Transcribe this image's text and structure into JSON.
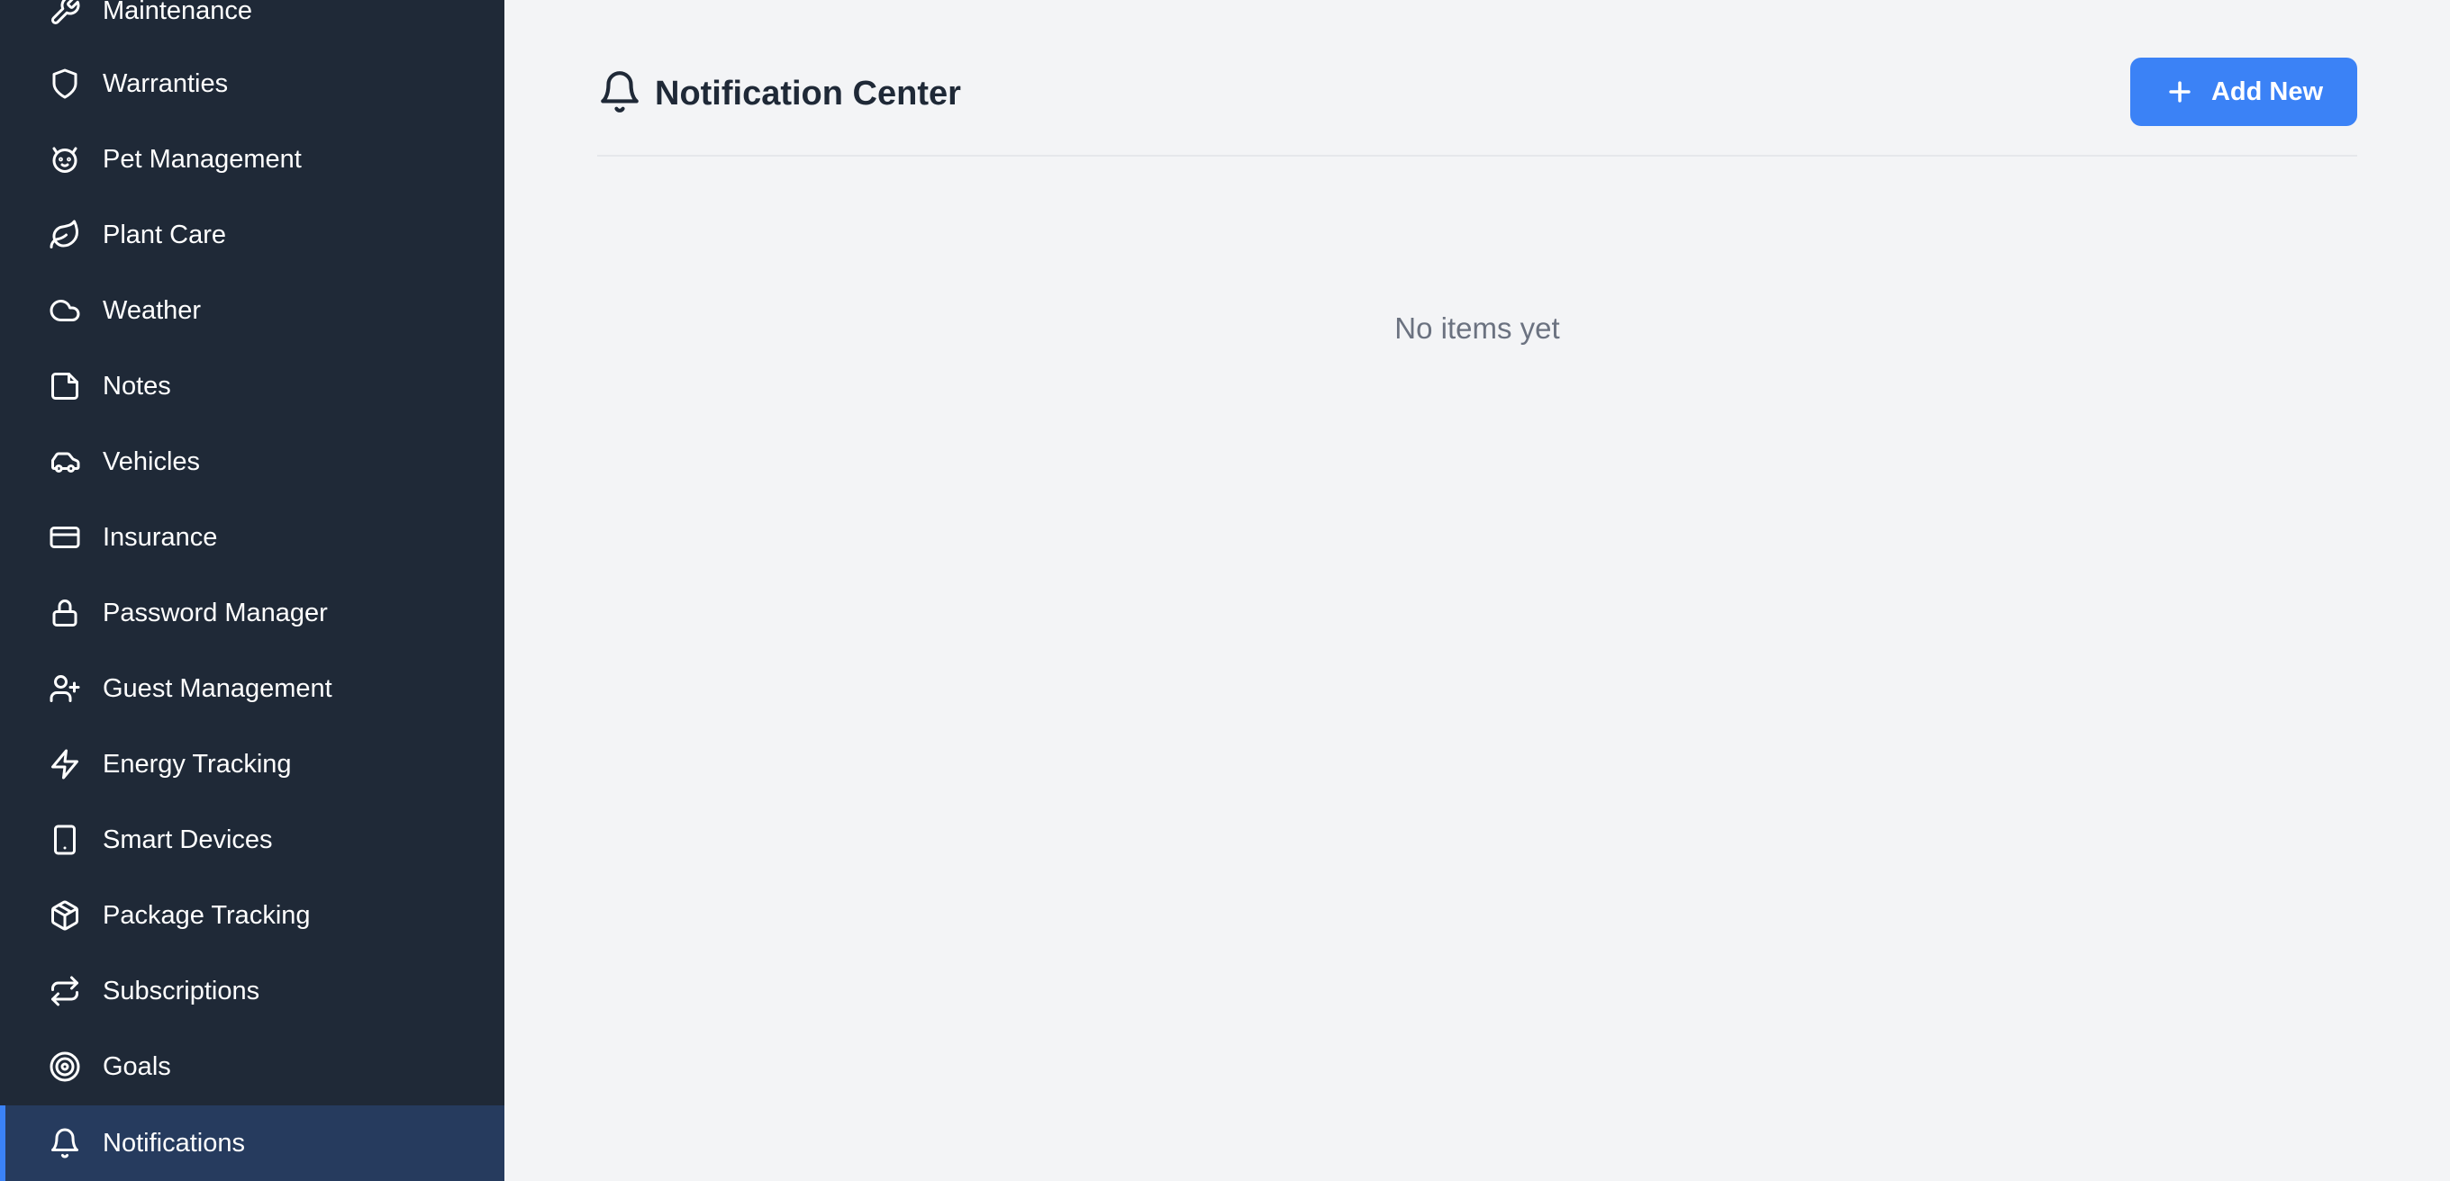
{
  "sidebar": {
    "items": [
      {
        "label": "Maintenance",
        "icon": "wrench-icon"
      },
      {
        "label": "Warranties",
        "icon": "shield-icon"
      },
      {
        "label": "Pet Management",
        "icon": "paw-icon"
      },
      {
        "label": "Plant Care",
        "icon": "leaf-icon"
      },
      {
        "label": "Weather",
        "icon": "cloud-icon"
      },
      {
        "label": "Notes",
        "icon": "note-icon"
      },
      {
        "label": "Vehicles",
        "icon": "car-icon"
      },
      {
        "label": "Insurance",
        "icon": "credit-card-icon"
      },
      {
        "label": "Password Manager",
        "icon": "lock-icon"
      },
      {
        "label": "Guest Management",
        "icon": "user-plus-icon"
      },
      {
        "label": "Energy Tracking",
        "icon": "lightning-icon"
      },
      {
        "label": "Smart Devices",
        "icon": "smartphone-icon"
      },
      {
        "label": "Package Tracking",
        "icon": "package-icon"
      },
      {
        "label": "Subscriptions",
        "icon": "repeat-icon"
      },
      {
        "label": "Goals",
        "icon": "target-icon"
      },
      {
        "label": "Notifications",
        "icon": "bell-icon",
        "active": true
      }
    ]
  },
  "header": {
    "title": "Notification Center",
    "add_label": "Add New"
  },
  "main": {
    "empty_text": "No items yet"
  },
  "colors": {
    "sidebar_bg": "#1f2937",
    "active_bg": "#263b5e",
    "accent": "#3b82f6",
    "page_bg": "#f3f4f6"
  }
}
